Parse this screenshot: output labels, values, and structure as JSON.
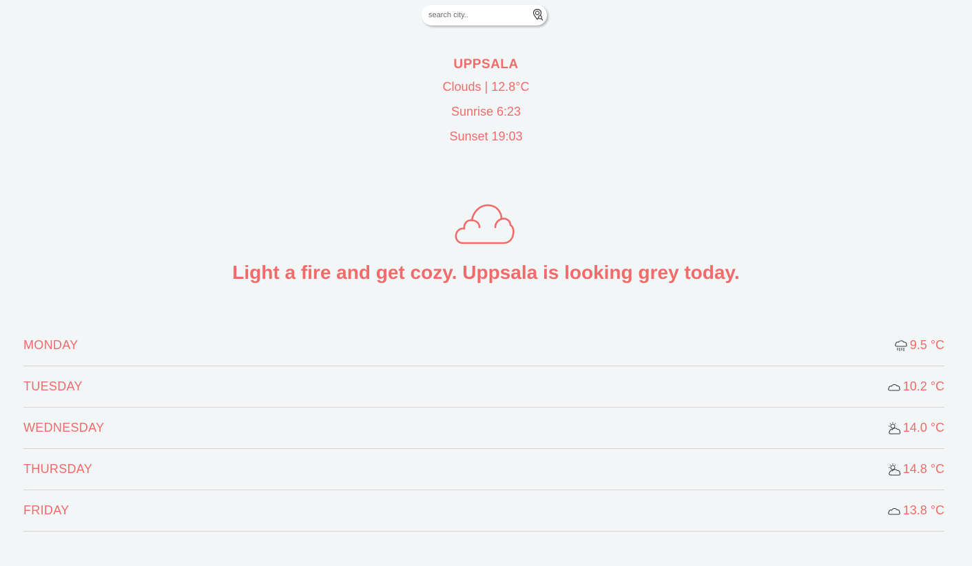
{
  "search": {
    "placeholder": "search city.."
  },
  "current": {
    "city": "UPPSALA",
    "conditions": "Clouds | 12.8°C",
    "sunrise": "Sunrise 6:23",
    "sunset": "Sunset 19:03",
    "icon": "cloud-icon"
  },
  "message": "Light a fire and get cozy. Uppsala is looking grey today.",
  "forecast": [
    {
      "day": "MONDAY",
      "temp": "9.5 °C",
      "icon": "rain-icon"
    },
    {
      "day": "TUESDAY",
      "temp": "10.2 °C",
      "icon": "cloud-icon"
    },
    {
      "day": "WEDNESDAY",
      "temp": "14.0 °C",
      "icon": "partly-sunny-icon"
    },
    {
      "day": "THURSDAY",
      "temp": "14.8 °C",
      "icon": "partly-sunny-icon"
    },
    {
      "day": "FRIDAY",
      "temp": "13.8 °C",
      "icon": "cloud-icon"
    }
  ],
  "colors": {
    "accent": "#f26b6b",
    "background": "#f2f6f7"
  }
}
